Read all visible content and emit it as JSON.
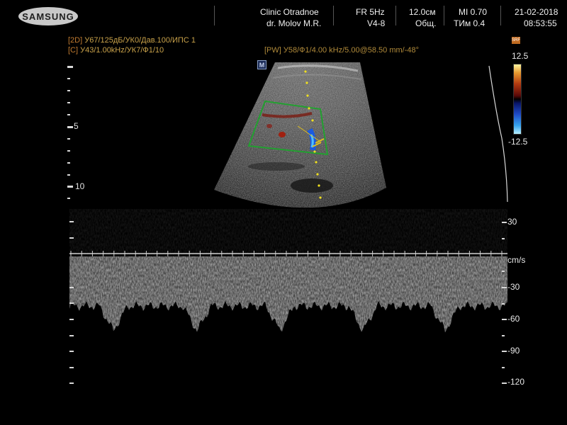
{
  "header": {
    "brand": "SAMSUNG",
    "clinic": "Clinic  Otradnoe",
    "doctor": "dr. Molov M.R.",
    "frame_rate": "FR 5Hz",
    "probe": "V4-8",
    "depth": "12.0см",
    "preset": "Общ.",
    "mi": "MI  0.70",
    "tim": "TИм  0.4",
    "date": "21-02-2018",
    "time": "08:53:55"
  },
  "params": {
    "line1_tag": "[2D]",
    "line1_val": " У67/125дБ/УК0/Дав.100/ИПС 1",
    "line2_tag": "[C]",
    "line2_val": " У43/1.00kHz/УК7/Ф1/10",
    "pw_line": "[PW] У58/Ф1/4.00 kHz/5.00@58.50 mm/-48°"
  },
  "image": {
    "marker": "M",
    "depth_labels": [
      "5",
      "10"
    ]
  },
  "color_scale": {
    "badge": "SRF",
    "top": "12.5",
    "bottom": "-12.5",
    "colors": {
      "top": "#fff6a0",
      "red": "#b33a10",
      "blue": "#1f4cc8",
      "bottom": "#b8f0ff"
    }
  },
  "doppler": {
    "unit": "cm/s",
    "scale_labels": [
      "30",
      "-30",
      "-60",
      "-90",
      "-120"
    ],
    "scale_values": [
      30,
      -30,
      -60,
      -90,
      -120
    ]
  }
}
